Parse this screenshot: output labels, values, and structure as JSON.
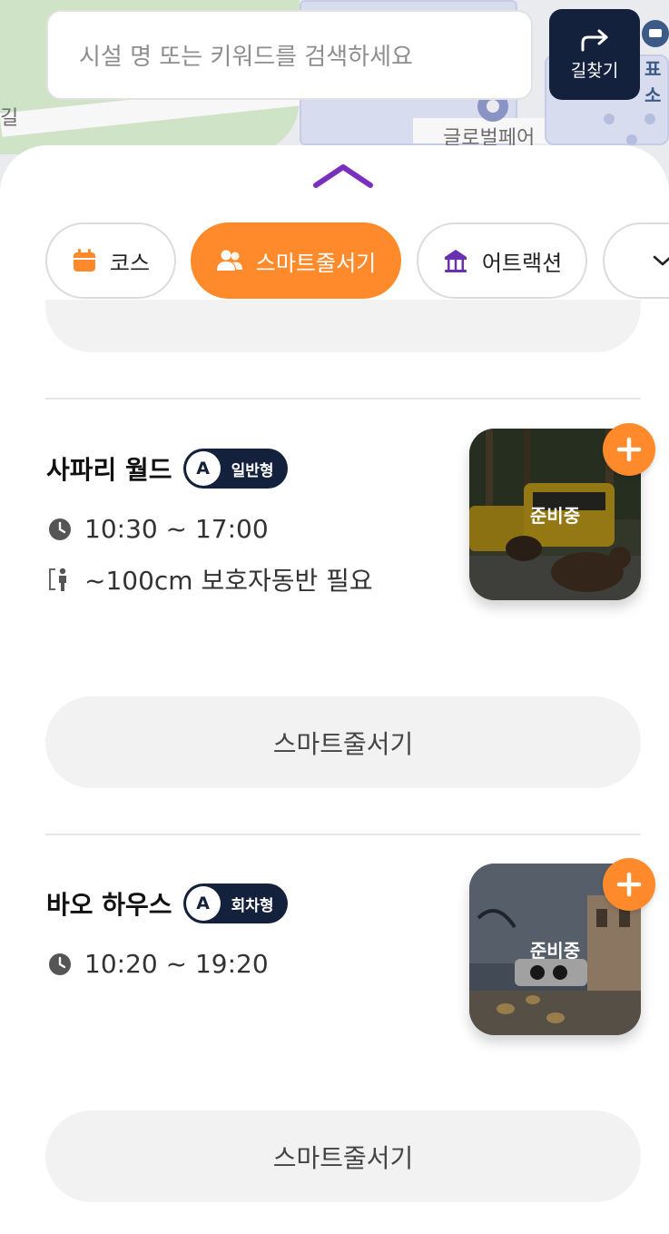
{
  "map": {
    "label_road": "길",
    "label_place": "글로벌페어",
    "label_ticket": "표소"
  },
  "search": {
    "placeholder": "시설 명 또는 키워드를 검색하세요",
    "route_button_label": "길찾기"
  },
  "categories": [
    {
      "label": "코스",
      "icon": "calendar-icon",
      "active": false
    },
    {
      "label": "스마트줄서기",
      "icon": "people-icon",
      "active": true
    },
    {
      "label": "어트랙션",
      "icon": "carousel-icon",
      "active": false
    }
  ],
  "attractions": [
    {
      "name": "사파리 월드",
      "grade": "A",
      "type": "일반형",
      "hours": "10:30 ~ 17:00",
      "requirement": "~100cm 보호자동반 필요",
      "status": "준비중",
      "image": "safari-bus-bear-photo",
      "button_label": "스마트줄서기"
    },
    {
      "name": "바오 하우스",
      "grade": "A",
      "type": "회차형",
      "hours": "10:20 ~ 19:20",
      "status": "준비중",
      "image": "panda-house-photo",
      "button_label": "스마트줄서기"
    }
  ],
  "colors": {
    "accent": "#ff8a2b",
    "navy": "#14213d",
    "handle": "#7b2fbf",
    "attraction_icon": "#6b2fb3"
  }
}
